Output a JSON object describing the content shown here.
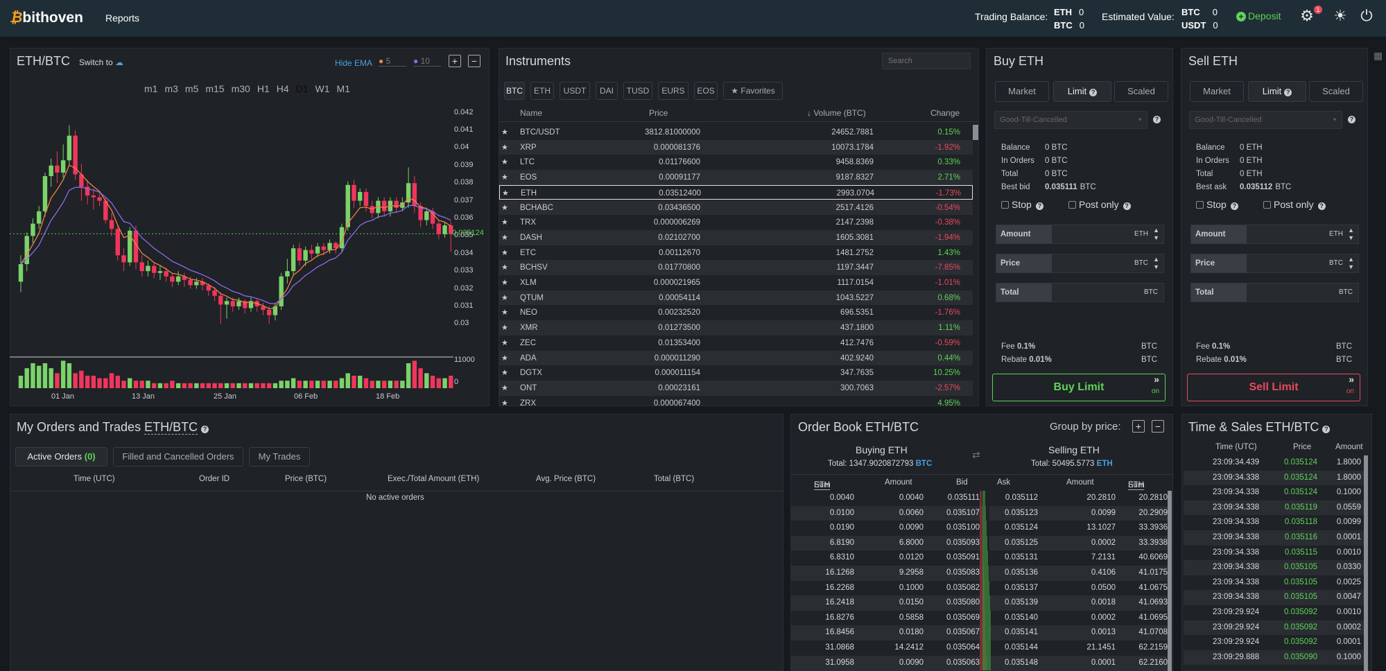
{
  "header": {
    "logo": "bithoven",
    "nav_reports": "Reports",
    "trading_balance_label": "Trading Balance:",
    "trading_balance": [
      {
        "cur": "ETH",
        "val": "0"
      },
      {
        "cur": "BTC",
        "val": "0"
      }
    ],
    "estimated_value_label": "Estimated Value:",
    "estimated_value": [
      {
        "cur": "BTC",
        "val": "0"
      },
      {
        "cur": "USDT",
        "val": "0"
      }
    ],
    "deposit": "Deposit",
    "notif_count": "1"
  },
  "chart": {
    "pair": "ETH/BTC",
    "switch_to": "Switch to",
    "hide_ema": "Hide EMA",
    "ema1": "5",
    "ema2": "10",
    "ema1_color": "#f0804a",
    "ema2_color": "#8a6cf0",
    "timeframes": [
      "m1",
      "m3",
      "m5",
      "m15",
      "m30",
      "H1",
      "H4",
      "D1",
      "W1",
      "M1"
    ],
    "active_tf": "D1",
    "current_price_label": "0.035124",
    "volume_ticks": [
      "11000",
      "0"
    ]
  },
  "chart_data": {
    "type": "candlestick",
    "y_ticks": [
      "0.042",
      "0.041",
      "0.04",
      "0.039",
      "0.038",
      "0.037",
      "0.036",
      "0.035",
      "0.034",
      "0.033",
      "0.032",
      "0.031",
      "0.03"
    ],
    "x_ticks": [
      "01 Jan",
      "13 Jan",
      "25 Jan",
      "06 Feb",
      "18 Feb"
    ],
    "ylim": [
      0.0295,
      0.0425
    ],
    "candles": [
      [
        0.0324,
        0.0334,
        0.0318,
        0.0339
      ],
      [
        0.0334,
        0.035,
        0.033,
        0.0352
      ],
      [
        0.035,
        0.0357,
        0.0346,
        0.036
      ],
      [
        0.0357,
        0.0364,
        0.0354,
        0.0367
      ],
      [
        0.0364,
        0.0384,
        0.0361,
        0.0386
      ],
      [
        0.0384,
        0.039,
        0.0378,
        0.0394
      ],
      [
        0.039,
        0.0386,
        0.038,
        0.0398
      ],
      [
        0.0386,
        0.0393,
        0.0383,
        0.0402
      ],
      [
        0.0393,
        0.0407,
        0.039,
        0.0413
      ],
      [
        0.0407,
        0.0385,
        0.0382,
        0.041
      ],
      [
        0.0385,
        0.0378,
        0.037,
        0.0391
      ],
      [
        0.0378,
        0.0373,
        0.0368,
        0.0382
      ],
      [
        0.0373,
        0.0372,
        0.0365,
        0.0377
      ],
      [
        0.0372,
        0.037,
        0.0367,
        0.0375
      ],
      [
        0.037,
        0.0359,
        0.0357,
        0.0372
      ],
      [
        0.0359,
        0.0354,
        0.035,
        0.0363
      ],
      [
        0.0354,
        0.0339,
        0.0336,
        0.0356
      ],
      [
        0.0339,
        0.0335,
        0.033,
        0.0343
      ],
      [
        0.0335,
        0.0353,
        0.0333,
        0.0355
      ],
      [
        0.0353,
        0.0335,
        0.0331,
        0.0356
      ],
      [
        0.0335,
        0.033,
        0.0327,
        0.0339
      ],
      [
        0.033,
        0.0333,
        0.0327,
        0.0336
      ],
      [
        0.0333,
        0.0329,
        0.0326,
        0.0335
      ],
      [
        0.0329,
        0.033,
        0.0325,
        0.0333
      ],
      [
        0.033,
        0.0327,
        0.0324,
        0.0332
      ],
      [
        0.0327,
        0.0324,
        0.0321,
        0.0329
      ],
      [
        0.0324,
        0.0327,
        0.0322,
        0.033
      ],
      [
        0.0327,
        0.0325,
        0.0321,
        0.0329
      ],
      [
        0.0325,
        0.0322,
        0.032,
        0.0327
      ],
      [
        0.0322,
        0.0324,
        0.032,
        0.0326
      ],
      [
        0.0324,
        0.0322,
        0.0319,
        0.0326
      ],
      [
        0.0322,
        0.0319,
        0.0316,
        0.0323
      ],
      [
        0.0319,
        0.0316,
        0.0313,
        0.0321
      ],
      [
        0.0316,
        0.0311,
        0.03,
        0.0318
      ],
      [
        0.0311,
        0.0313,
        0.0303,
        0.0315
      ],
      [
        0.0313,
        0.031,
        0.0307,
        0.0315
      ],
      [
        0.031,
        0.0313,
        0.0308,
        0.0315
      ],
      [
        0.0313,
        0.0309,
        0.0306,
        0.0314
      ],
      [
        0.0309,
        0.0313,
        0.0307,
        0.0315
      ],
      [
        0.0313,
        0.031,
        0.0307,
        0.0314
      ],
      [
        0.031,
        0.0308,
        0.0305,
        0.0312
      ],
      [
        0.0308,
        0.0305,
        0.03,
        0.031
      ],
      [
        0.0305,
        0.031,
        0.0302,
        0.0312
      ],
      [
        0.031,
        0.0327,
        0.0308,
        0.0329
      ],
      [
        0.0327,
        0.033,
        0.0323,
        0.0337
      ],
      [
        0.033,
        0.0343,
        0.0328,
        0.0345
      ],
      [
        0.0343,
        0.0336,
        0.0333,
        0.0346
      ],
      [
        0.0336,
        0.0342,
        0.0333,
        0.0344
      ],
      [
        0.0342,
        0.034,
        0.0337,
        0.0345
      ],
      [
        0.034,
        0.0344,
        0.0338,
        0.0346
      ],
      [
        0.0344,
        0.0342,
        0.0339,
        0.0346
      ],
      [
        0.0342,
        0.0346,
        0.034,
        0.0348
      ],
      [
        0.0346,
        0.0343,
        0.034,
        0.0347
      ],
      [
        0.0343,
        0.0355,
        0.0341,
        0.0357
      ],
      [
        0.0355,
        0.0379,
        0.0353,
        0.0381
      ],
      [
        0.0379,
        0.037,
        0.0366,
        0.0382
      ],
      [
        0.037,
        0.0375,
        0.0367,
        0.0377
      ],
      [
        0.0375,
        0.0367,
        0.0364,
        0.0377
      ],
      [
        0.0367,
        0.0363,
        0.036,
        0.037
      ],
      [
        0.0363,
        0.037,
        0.036,
        0.0372
      ],
      [
        0.037,
        0.0364,
        0.0361,
        0.0372
      ],
      [
        0.0364,
        0.037,
        0.0361,
        0.0372
      ],
      [
        0.037,
        0.0366,
        0.0363,
        0.0372
      ],
      [
        0.0366,
        0.0369,
        0.0364,
        0.0372
      ],
      [
        0.0369,
        0.038,
        0.0366,
        0.0389
      ],
      [
        0.038,
        0.0367,
        0.0363,
        0.0384
      ],
      [
        0.0367,
        0.0359,
        0.0355,
        0.0369
      ],
      [
        0.0359,
        0.0364,
        0.0356,
        0.0366
      ],
      [
        0.0364,
        0.0357,
        0.0354,
        0.0366
      ],
      [
        0.0357,
        0.0351,
        0.0348,
        0.0359
      ],
      [
        0.0351,
        0.0356,
        0.0349,
        0.0358
      ],
      [
        0.0356,
        0.0351,
        0.0341,
        0.0358
      ]
    ],
    "volumes": [
      5,
      8,
      10,
      9,
      10,
      8,
      6,
      11,
      10,
      6,
      7,
      5,
      5,
      4,
      4,
      6,
      5,
      3,
      4,
      3,
      3,
      3,
      2,
      2,
      2,
      3,
      2,
      2,
      2,
      2,
      2,
      2,
      2,
      2,
      2,
      2,
      2,
      2,
      2,
      2,
      2,
      2,
      2,
      3,
      3,
      4,
      3,
      3,
      3,
      3,
      3,
      3,
      3,
      4,
      6,
      5,
      5,
      4,
      3,
      3,
      3,
      3,
      3,
      3,
      10,
      11,
      8,
      6,
      5,
      4,
      4,
      5
    ],
    "ema5": "orange line",
    "ema10": "purple line"
  },
  "instruments": {
    "title": "Instruments",
    "search_placeholder": "Search",
    "tabs": [
      "BTC",
      "ETH",
      "USDT",
      "DAI",
      "TUSD",
      "EURS",
      "EOS",
      "★ Favorites"
    ],
    "active_tab": "BTC",
    "columns": [
      "Name",
      "Price",
      "Volume (BTC)",
      "Change"
    ],
    "rows": [
      {
        "name": "BTC/USDT",
        "price": "3812.81000000",
        "volume": "24652.7881",
        "change": "0.15%",
        "dir": "pos"
      },
      {
        "name": "XRP",
        "price": "0.000081376",
        "volume": "10073.1784",
        "change": "-1.92%",
        "dir": "neg"
      },
      {
        "name": "LTC",
        "price": "0.01176600",
        "volume": "9458.8369",
        "change": "0.33%",
        "dir": "pos"
      },
      {
        "name": "EOS",
        "price": "0.00091177",
        "volume": "9187.8327",
        "change": "2.71%",
        "dir": "pos"
      },
      {
        "name": "ETH",
        "price": "0.03512400",
        "volume": "2993.0704",
        "change": "-1.73%",
        "dir": "neg",
        "selected": true
      },
      {
        "name": "BCHABC",
        "price": "0.03436500",
        "volume": "2517.4126",
        "change": "-0.54%",
        "dir": "neg"
      },
      {
        "name": "TRX",
        "price": "0.000006269",
        "volume": "2147.2398",
        "change": "-0.38%",
        "dir": "neg"
      },
      {
        "name": "DASH",
        "price": "0.02102700",
        "volume": "1605.3081",
        "change": "-1.94%",
        "dir": "neg"
      },
      {
        "name": "ETC",
        "price": "0.00112670",
        "volume": "1481.2752",
        "change": "1.43%",
        "dir": "pos"
      },
      {
        "name": "BCHSV",
        "price": "0.01770800",
        "volume": "1197.3447",
        "change": "-7.85%",
        "dir": "neg"
      },
      {
        "name": "XLM",
        "price": "0.000021965",
        "volume": "1117.0154",
        "change": "-1.01%",
        "dir": "neg"
      },
      {
        "name": "QTUM",
        "price": "0.00054114",
        "volume": "1043.5227",
        "change": "0.68%",
        "dir": "pos"
      },
      {
        "name": "NEO",
        "price": "0.00232520",
        "volume": "696.5351",
        "change": "-1.76%",
        "dir": "neg"
      },
      {
        "name": "XMR",
        "price": "0.01273500",
        "volume": "437.1800",
        "change": "1.11%",
        "dir": "pos"
      },
      {
        "name": "ZEC",
        "price": "0.01353400",
        "volume": "412.7476",
        "change": "-0.59%",
        "dir": "neg"
      },
      {
        "name": "ADA",
        "price": "0.000011290",
        "volume": "402.9240",
        "change": "0.44%",
        "dir": "pos"
      },
      {
        "name": "DGTX",
        "price": "0.000011154",
        "volume": "347.7635",
        "change": "10.25%",
        "dir": "pos"
      },
      {
        "name": "ONT",
        "price": "0.00023161",
        "volume": "300.7063",
        "change": "-2.57%",
        "dir": "neg"
      },
      {
        "name": "ZRX",
        "price": "0.000067400",
        "volume": "",
        "change": "4.95%",
        "dir": "pos"
      }
    ]
  },
  "buy": {
    "title": "Buy ETH",
    "tabs": [
      "Market",
      "Limit",
      "Scaled"
    ],
    "tif": "Good-Till-Cancelled",
    "balance": "0 BTC",
    "in_orders": "0 BTC",
    "total": "0 BTC",
    "best_label": "Best bid",
    "best_val": "0.035111",
    "best_unit": "BTC",
    "stop": "Stop",
    "post_only": "Post only",
    "amount_unit": "ETH",
    "price_unit": "BTC",
    "total_unit": "BTC",
    "fee": "0.1%",
    "rebate": "0.01%",
    "fee_unit": "BTC",
    "button": "Buy Limit",
    "on": "on"
  },
  "sell": {
    "title": "Sell ETH",
    "tabs": [
      "Market",
      "Limit",
      "Scaled"
    ],
    "tif": "Good-Till-Cancelled",
    "balance": "0 ETH",
    "in_orders": "0 ETH",
    "total": "0 ETH",
    "best_label": "Best ask",
    "best_val": "0.035112",
    "best_unit": "BTC",
    "stop": "Stop",
    "post_only": "Post only",
    "amount_unit": "ETH",
    "price_unit": "BTC",
    "total_unit": "BTC",
    "fee": "0.1%",
    "rebate": "0.01%",
    "fee_unit": "BTC",
    "button": "Sell Limit",
    "on": "on"
  },
  "labels": {
    "balance": "Balance",
    "in_orders": "In Orders",
    "total": "Total",
    "amount": "Amount",
    "price": "Price",
    "total_field": "Total",
    "fee": "Fee",
    "rebate": "Rebate"
  },
  "orders": {
    "title": "My Orders and Trades",
    "pair": "ETH/BTC",
    "tabs": [
      "Active Orders",
      "Filled and Cancelled Orders",
      "My Trades"
    ],
    "active_count": "(0)",
    "columns": [
      "Time (UTC)",
      "Order ID",
      "Price (BTC)",
      "Exec./Total Amount (ETH)",
      "Avg. Price (BTC)",
      "Total (BTC)"
    ],
    "empty": "No active orders"
  },
  "orderbook": {
    "title": "Order Book ETH/BTC",
    "group_by": "Group by price:",
    "buying": "Buying ETH",
    "buying_total": "Total: 1347.9020872793",
    "buying_cur": "BTC",
    "selling": "Selling ETH",
    "selling_total": "Total: 50495.5773",
    "selling_cur": "ETH",
    "bid_cols": [
      "Sum",
      "ETH",
      "Amount",
      "Bid"
    ],
    "ask_cols": [
      "Ask",
      "Amount",
      "Sum",
      "ETH"
    ],
    "bids": [
      [
        "0.0040",
        "0.0040",
        "0.035111"
      ],
      [
        "0.0100",
        "0.0060",
        "0.035107"
      ],
      [
        "0.0190",
        "0.0090",
        "0.035100"
      ],
      [
        "6.8190",
        "6.8000",
        "0.035093"
      ],
      [
        "6.8310",
        "0.0120",
        "0.035091"
      ],
      [
        "16.1268",
        "9.2958",
        "0.035083"
      ],
      [
        "16.2268",
        "0.1000",
        "0.035082"
      ],
      [
        "16.2418",
        "0.0150",
        "0.035080"
      ],
      [
        "16.8276",
        "0.5858",
        "0.035069"
      ],
      [
        "16.8456",
        "0.0180",
        "0.035067"
      ],
      [
        "31.0868",
        "14.2412",
        "0.035064"
      ],
      [
        "31.0958",
        "0.0090",
        "0.035063"
      ]
    ],
    "asks": [
      [
        "0.035112",
        "20.2810",
        "20.2810"
      ],
      [
        "0.035123",
        "0.0099",
        "20.2909"
      ],
      [
        "0.035124",
        "13.1027",
        "33.3936"
      ],
      [
        "0.035125",
        "0.0002",
        "33.3938"
      ],
      [
        "0.035131",
        "7.2131",
        "40.6069"
      ],
      [
        "0.035136",
        "0.4106",
        "41.0175"
      ],
      [
        "0.035137",
        "0.0500",
        "41.0675"
      ],
      [
        "0.035139",
        "0.0018",
        "41.0693"
      ],
      [
        "0.035140",
        "0.0002",
        "41.0695"
      ],
      [
        "0.035141",
        "0.0013",
        "41.0708"
      ],
      [
        "0.035144",
        "21.1451",
        "62.2159"
      ],
      [
        "0.035148",
        "0.0001",
        "62.2160"
      ]
    ]
  },
  "times_sales": {
    "title": "Time & Sales ETH/BTC",
    "columns": [
      "Time (UTC)",
      "Price",
      "Amount"
    ],
    "rows": [
      [
        "23:09:34.439",
        "0.035124",
        "1.8000"
      ],
      [
        "23:09:34.338",
        "0.035124",
        "1.8000"
      ],
      [
        "23:09:34.338",
        "0.035124",
        "0.1000"
      ],
      [
        "23:09:34.338",
        "0.035119",
        "0.0559"
      ],
      [
        "23:09:34.338",
        "0.035118",
        "0.0099"
      ],
      [
        "23:09:34.338",
        "0.035116",
        "0.0001"
      ],
      [
        "23:09:34.338",
        "0.035115",
        "0.0010"
      ],
      [
        "23:09:34.338",
        "0.035105",
        "0.0330"
      ],
      [
        "23:09:34.338",
        "0.035105",
        "0.0025"
      ],
      [
        "23:09:34.338",
        "0.035105",
        "0.0047"
      ],
      [
        "23:09:29.924",
        "0.035092",
        "0.0010"
      ],
      [
        "23:09:29.924",
        "0.035092",
        "0.0002"
      ],
      [
        "23:09:29.924",
        "0.035092",
        "0.0001"
      ],
      [
        "23:09:29.888",
        "0.035090",
        "0.1000"
      ]
    ]
  }
}
